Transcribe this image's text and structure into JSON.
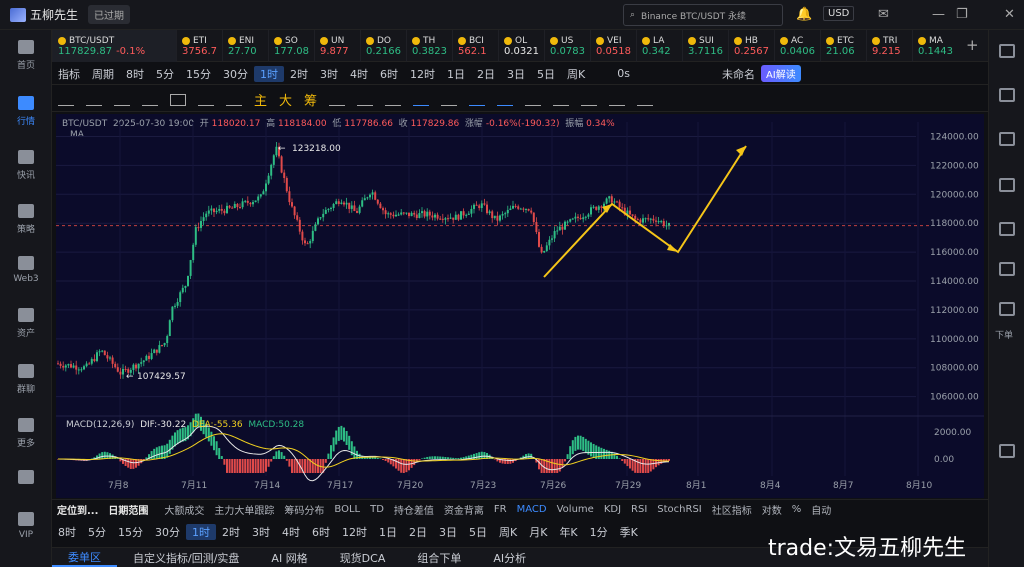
{
  "app": {
    "title": "五柳先生",
    "expired": "已过期",
    "search": "Binance BTC/USDT 永续",
    "currency": "USD"
  },
  "sidebar": [
    {
      "label": "首页"
    },
    {
      "label": "行情"
    },
    {
      "label": "快讯"
    },
    {
      "label": "策略"
    },
    {
      "label": "Web3"
    },
    {
      "label": "资产"
    },
    {
      "label": "群聊"
    },
    {
      "label": "更多"
    },
    {
      "label": ""
    },
    {
      "label": "VIP"
    }
  ],
  "rightbar": {
    "next_label": "下单"
  },
  "tickers": [
    {
      "name": "BTC/USDT",
      "price": "117829.87",
      "change": "-0.1%"
    },
    {
      "name": "ETI",
      "price": "3756.7",
      "change": ""
    },
    {
      "name": "ENI",
      "price": "27.70",
      "change": ""
    },
    {
      "name": "SO",
      "price": "177.08",
      "change": ""
    },
    {
      "name": "UN",
      "price": "9.877",
      "change": ""
    },
    {
      "name": "DO",
      "price": "0.2166",
      "change": ""
    },
    {
      "name": "TH",
      "price": "0.3823",
      "change": ""
    },
    {
      "name": "BCI",
      "price": "562.1",
      "change": ""
    },
    {
      "name": "OL",
      "price": "0.0321",
      "change": ""
    },
    {
      "name": "US",
      "price": "0.0783",
      "change": ""
    },
    {
      "name": "VEI",
      "price": "0.0518",
      "change": ""
    },
    {
      "name": "LA",
      "price": "0.342",
      "change": ""
    },
    {
      "name": "SUI",
      "price": "3.7116",
      "change": ""
    },
    {
      "name": "HB",
      "price": "0.2567",
      "change": ""
    },
    {
      "name": "AC",
      "price": "0.0406",
      "change": ""
    },
    {
      "name": "ETC",
      "price": "21.06",
      "change": ""
    },
    {
      "name": "TRI",
      "price": "9.215",
      "change": ""
    },
    {
      "name": "MA",
      "price": "0.1443",
      "change": ""
    }
  ],
  "toolbar1": {
    "items": [
      "指标",
      "周期",
      "8时",
      "5分",
      "15分",
      "30分",
      "1时",
      "2时",
      "3时",
      "4时",
      "6时",
      "12时",
      "1日",
      "2日",
      "3日",
      "5日",
      "周K"
    ],
    "selected": "1时",
    "countdown": "0s",
    "unnamed": "未命名",
    "ai": "AI解读"
  },
  "toolbar2": {
    "labels": [
      "主",
      "大",
      "筹"
    ]
  },
  "chart": {
    "pair": "BTC/USDT",
    "time": "2025-07-30 19:00",
    "open_l": "开",
    "open": "118020.17",
    "high_l": "高",
    "high": "118184.00",
    "low_l": "低",
    "low": "117786.66",
    "close_l": "收",
    "close": "117829.86",
    "chg_l": "涨幅",
    "chg": "-0.16%(-190.32)",
    "amp_l": "振幅",
    "amp": "0.34%",
    "ma": "MA",
    "max_label": "123218.00",
    "min_label": "107429.57",
    "y_ticks": [
      "124000.00",
      "122000.00",
      "120000.00",
      "118000.00",
      "116000.00",
      "114000.00",
      "112000.00",
      "110000.00",
      "108000.00",
      "106000.00"
    ],
    "x_ticks": [
      "7月8",
      "7月11",
      "7月14",
      "7月17",
      "7月20",
      "7月23",
      "7月26",
      "7月29",
      "8月1",
      "8月4",
      "8月7",
      "8月10"
    ],
    "macd": {
      "label": "MACD(12,26,9)",
      "dif": "DIF:-30.22",
      "dea": "DEA:-55.36",
      "macd": "MACD:50.28",
      "y_ticks": [
        "2000.00",
        "0.00"
      ]
    }
  },
  "bottom1": {
    "items": [
      "定位到...",
      "日期范围",
      "大额成交",
      "主力大单跟踪",
      "筹码分布",
      "BOLL",
      "TD",
      "持仓差值",
      "资金背离",
      "FR",
      "MACD",
      "Volume",
      "KDJ",
      "RSI",
      "StochRSI",
      "社区指标",
      "对数",
      "%",
      "自动"
    ],
    "selected": "MACD"
  },
  "bottom2": {
    "items": [
      "8时",
      "5分",
      "15分",
      "30分",
      "1时",
      "2时",
      "3时",
      "4时",
      "6时",
      "12时",
      "1日",
      "2日",
      "3日",
      "5日",
      "周K",
      "月K",
      "年K",
      "1分",
      "季K"
    ],
    "selected": "1时"
  },
  "bottom3": {
    "items": [
      "委单区",
      "自定义指标/回测/实盘",
      "AI 网格",
      "现货DCA",
      "组合下单",
      "AI分析"
    ],
    "selected": "委单区"
  },
  "watermark": "trade:文易五柳先生"
}
